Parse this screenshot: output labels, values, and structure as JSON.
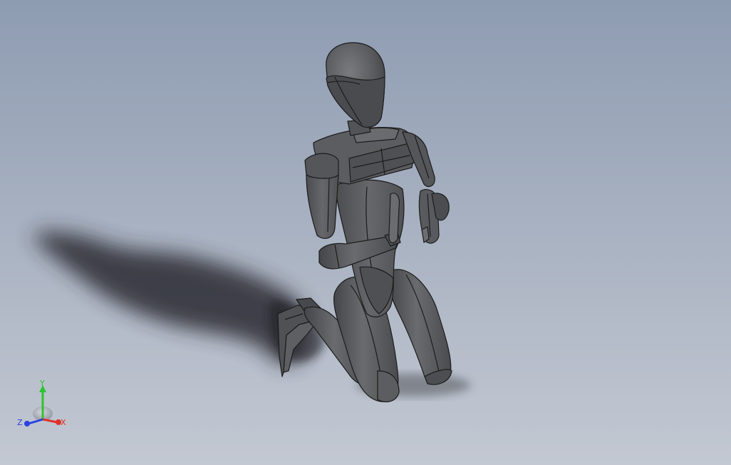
{
  "viewport": {
    "background_top": "#8e9cb2",
    "background_bottom": "#c3c8d2",
    "model_color": "#5b5c5e",
    "edge_color": "#1c1c1c"
  },
  "model": {
    "kind": "kneeling mannequin figure"
  },
  "triad": {
    "x_label": "X",
    "y_label": "Y",
    "z_label": "Z",
    "x_color": "#e0312b",
    "y_color": "#2ec42e",
    "z_color": "#2b42e0"
  }
}
